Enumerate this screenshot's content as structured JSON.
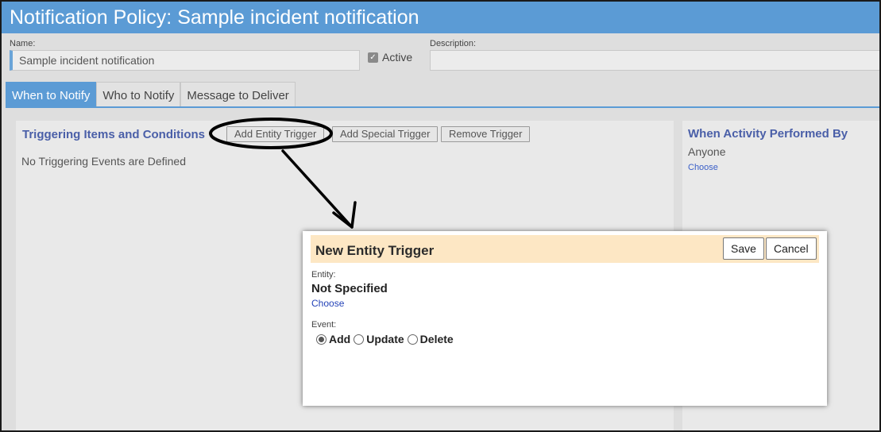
{
  "window": {
    "title": "Notification Policy: Sample incident notification"
  },
  "form": {
    "name_label": "Name:",
    "name_value": "Sample incident notification",
    "active_label": "Active",
    "active_checked": true,
    "description_label": "Description:",
    "description_value": ""
  },
  "tabs": [
    {
      "label": "When to Notify",
      "active": true
    },
    {
      "label": "Who to Notify",
      "active": false
    },
    {
      "label": "Message to Deliver",
      "active": false
    }
  ],
  "triggers": {
    "heading": "Triggering Items and Conditions",
    "add_entity_label": "Add Entity Trigger",
    "add_special_label": "Add Special Trigger",
    "remove_label": "Remove Trigger",
    "empty_text": "No Triggering Events are Defined"
  },
  "activity": {
    "heading": "When Activity Performed By",
    "value": "Anyone",
    "choose_label": "Choose"
  },
  "dialog": {
    "title": "New Entity Trigger",
    "save_label": "Save",
    "cancel_label": "Cancel",
    "entity_label": "Entity:",
    "entity_value": "Not Specified",
    "entity_choose_label": "Choose",
    "event_label": "Event:",
    "event_options": [
      {
        "label": "Add",
        "selected": true
      },
      {
        "label": "Update",
        "selected": false
      },
      {
        "label": "Delete",
        "selected": false
      }
    ]
  },
  "colors": {
    "accent": "#5b9bd5",
    "heading": "#4a5fa8",
    "dialog_header": "#fde7c4",
    "link": "#2443b8"
  }
}
